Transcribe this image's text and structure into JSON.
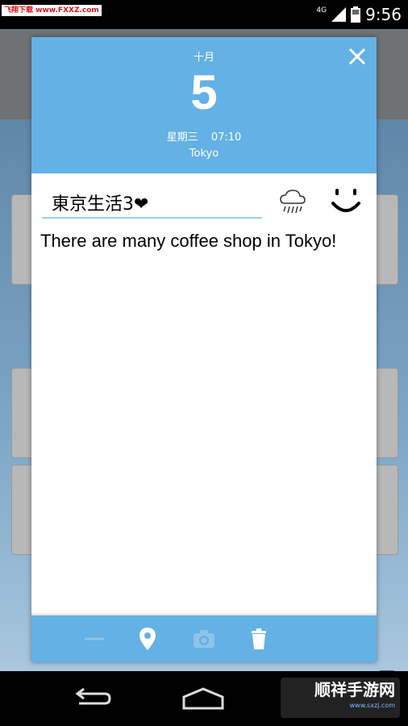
{
  "status_bar": {
    "watermark": "飞翔下载 www.FXXZ.com",
    "network": "4G",
    "time": "9:56"
  },
  "diary_entry": {
    "month": "十月",
    "day": "5",
    "weekday": "星期三",
    "time": "07:10",
    "city": "Tokyo",
    "title": "東京生活3❤",
    "body": "There are many coffee shop in Tokyo!",
    "weather_icon": "rain-cloud-icon",
    "mood_icon": "smiley-face-icon"
  },
  "toolbar": {
    "items": [
      "divider-icon",
      "location-pin-icon",
      "camera-icon",
      "trash-icon"
    ]
  },
  "watermark_corner": {
    "text": "顺祥手游网",
    "subtext": "www.sxzj.com"
  },
  "colors": {
    "header_blue": "#64b1e5",
    "underline_blue": "#9cd0ef"
  }
}
